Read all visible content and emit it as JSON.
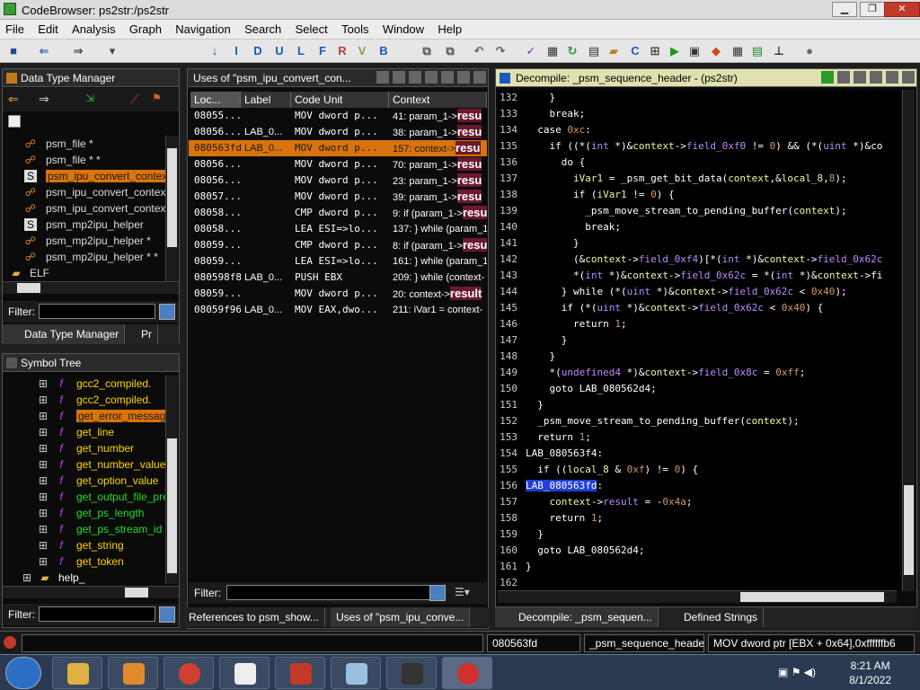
{
  "window": {
    "title": "CodeBrowser: ps2str:/ps2str"
  },
  "menu": [
    "File",
    "Edit",
    "Analysis",
    "Graph",
    "Navigation",
    "Search",
    "Select",
    "Tools",
    "Window",
    "Help"
  ],
  "toolbar_letters": {
    "i": "I",
    "d": "D",
    "u": "U",
    "l": "L",
    "f": "F",
    "r": "R",
    "v": "V",
    "b": "B"
  },
  "data_type_manager": {
    "title": "Data Type Manager",
    "items": [
      {
        "label": "psm_file *",
        "icon": "folder-struct-icon"
      },
      {
        "label": "psm_file * *",
        "icon": "folder-struct-icon"
      },
      {
        "label": "psm_ipu_convert_context",
        "icon": "struct-icon",
        "selected": true
      },
      {
        "label": "psm_ipu_convert_context",
        "icon": "folder-struct-icon"
      },
      {
        "label": "psm_ipu_convert_context",
        "icon": "folder-struct-icon"
      },
      {
        "label": "psm_mp2ipu_helper",
        "icon": "struct-icon"
      },
      {
        "label": "psm_mp2ipu_helper *",
        "icon": "folder-struct-icon"
      },
      {
        "label": "psm_mp2ipu_helper * *",
        "icon": "folder-struct-icon"
      },
      {
        "label": "ELF",
        "icon": "folder-icon"
      }
    ],
    "filter_label": "Filter:",
    "tabs": [
      "Data Type Manager",
      "Pr"
    ]
  },
  "symbol_tree": {
    "title": "Symbol Tree",
    "items": [
      {
        "label": "gcc2_compiled.",
        "color": "#ffd400"
      },
      {
        "label": "gcc2_compiled.",
        "color": "#ffd400"
      },
      {
        "label": "get_error_message",
        "color": "#1a1a1a",
        "selected": true
      },
      {
        "label": "get_line",
        "color": "#ffd400"
      },
      {
        "label": "get_number",
        "color": "#ffd400"
      },
      {
        "label": "get_number_value",
        "color": "#ffd400"
      },
      {
        "label": "get_option_value",
        "color": "#ffd400"
      },
      {
        "label": "get_output_file_pre",
        "color": "#22dd22"
      },
      {
        "label": "get_ps_length",
        "color": "#22dd22"
      },
      {
        "label": "get_ps_stream_id",
        "color": "#22dd22"
      },
      {
        "label": "get_string",
        "color": "#ffd400"
      },
      {
        "label": "get_token",
        "color": "#ffd400"
      },
      {
        "label": "help_",
        "color": "#ffffff",
        "folder": true
      },
      {
        "label": "i",
        "color": "#ffffff",
        "folder": true
      }
    ],
    "filter_label": "Filter:"
  },
  "uses_panel": {
    "title": "Uses of \"psm_ipu_convert_con...",
    "columns": [
      "Loc...",
      "Label",
      "Code Unit",
      "Context"
    ],
    "rows": [
      {
        "loc": "08055...",
        "label": "",
        "code": "MOV dword p...",
        "ctx": "41: param_1->",
        "hl": "resu"
      },
      {
        "loc": "08056...",
        "label": "LAB_0...",
        "code": "MOV dword p...",
        "ctx": "38: param_1->",
        "hl": "resu"
      },
      {
        "loc": "080563fd",
        "label": "LAB_0...",
        "code": "MOV dword p...",
        "ctx": "157: context->",
        "hl": "resu",
        "selected": true
      },
      {
        "loc": "08056...",
        "label": "",
        "code": "MOV dword p...",
        "ctx": "70: param_1->",
        "hl": "resu"
      },
      {
        "loc": "08056...",
        "label": "",
        "code": "MOV dword p...",
        "ctx": "23: param_1->",
        "hl": "resu"
      },
      {
        "loc": "08057...",
        "label": "",
        "code": "MOV dword p...",
        "ctx": "39: param_1->",
        "hl": "resu"
      },
      {
        "loc": "08058...",
        "label": "",
        "code": "CMP dword p...",
        "ctx": "9: if (param_1->",
        "hl": "resu"
      },
      {
        "loc": "08058...",
        "label": "",
        "code": "LEA ESI=>lo...",
        "ctx": "137: } while (param_1",
        "hl": ""
      },
      {
        "loc": "08059...",
        "label": "",
        "code": "CMP dword p...",
        "ctx": "8: if (param_1->",
        "hl": "resu"
      },
      {
        "loc": "08059...",
        "label": "",
        "code": "LEA ESI=>lo...",
        "ctx": "161: } while (param_1",
        "hl": ""
      },
      {
        "loc": "080598f8",
        "label": "LAB_0...",
        "code": "PUSH EBX",
        "ctx": "209: } while (context-",
        "hl": ""
      },
      {
        "loc": "08059...",
        "label": "",
        "code": "MOV dword p...",
        "ctx": "20: context->",
        "hl": "result"
      },
      {
        "loc": "08059f96",
        "label": "LAB_0...",
        "code": "MOV EAX,dwo...",
        "ctx": "211: iVar1 = context-",
        "hl": ""
      }
    ],
    "filter_label": "Filter:",
    "tabs": [
      "References to psm_show...",
      "Uses of \"psm_ipu_conve..."
    ]
  },
  "decompile": {
    "title": "Decompile: _psm_sequence_header -  (ps2str)",
    "lines": [
      {
        "n": "132",
        "t": "    }"
      },
      {
        "n": "133",
        "t": "    break;"
      },
      {
        "n": "134",
        "t": "  case 0xc:"
      },
      {
        "n": "135",
        "t": "    if ((*(int *)&context->field_0xf0 != 0) && (*(uint *)&co"
      },
      {
        "n": "136",
        "t": "      do {"
      },
      {
        "n": "137",
        "t": "        iVar1 = _psm_get_bit_data(context,&local_8,8);"
      },
      {
        "n": "138",
        "t": "        if (iVar1 != 0) {"
      },
      {
        "n": "139",
        "t": "          _psm_move_stream_to_pending_buffer(context);"
      },
      {
        "n": "140",
        "t": "          break;"
      },
      {
        "n": "141",
        "t": "        }"
      },
      {
        "n": "142",
        "t": "        (&context->field_0xf4)[*(int *)&context->field_0x62c"
      },
      {
        "n": "143",
        "t": "        *(int *)&context->field_0x62c = *(int *)&context->fi"
      },
      {
        "n": "144",
        "t": "      } while (*(uint *)&context->field_0x62c < 0x40);"
      },
      {
        "n": "145",
        "t": "      if (*(uint *)&context->field_0x62c < 0x40) {"
      },
      {
        "n": "146",
        "t": "        return 1;"
      },
      {
        "n": "147",
        "t": "      }"
      },
      {
        "n": "148",
        "t": "    }"
      },
      {
        "n": "149",
        "t": "    *(undefined4 *)&context->field_0x8c = 0xff;"
      },
      {
        "n": "150",
        "t": "    goto LAB_080562d4;"
      },
      {
        "n": "151",
        "t": "  }"
      },
      {
        "n": "152",
        "t": "  _psm_move_stream_to_pending_buffer(context);"
      },
      {
        "n": "153",
        "t": "  return 1;"
      },
      {
        "n": "154",
        "t": "LAB_080563f4:"
      },
      {
        "n": "155",
        "t": "  if ((local_8 & 0xf) != 0) {"
      },
      {
        "n": "156",
        "t": "LAB_080563fd:",
        "hl": true
      },
      {
        "n": "157",
        "t": "    context->result = -0x4a;"
      },
      {
        "n": "158",
        "t": "    return 1;"
      },
      {
        "n": "159",
        "t": "  }"
      },
      {
        "n": "160",
        "t": "  goto LAB_080562d4;"
      },
      {
        "n": "161",
        "t": "}"
      },
      {
        "n": "162",
        "t": ""
      }
    ],
    "tabs": [
      "Decompile: _psm_sequen...",
      "Defined Strings"
    ]
  },
  "status": {
    "address": "080563fd",
    "function": "_psm_sequence_header",
    "instruction": "MOV dword ptr [EBX + 0x64],0xffffffb6"
  },
  "taskbar": {
    "time": "8:21 AM",
    "date": "8/1/2022"
  }
}
